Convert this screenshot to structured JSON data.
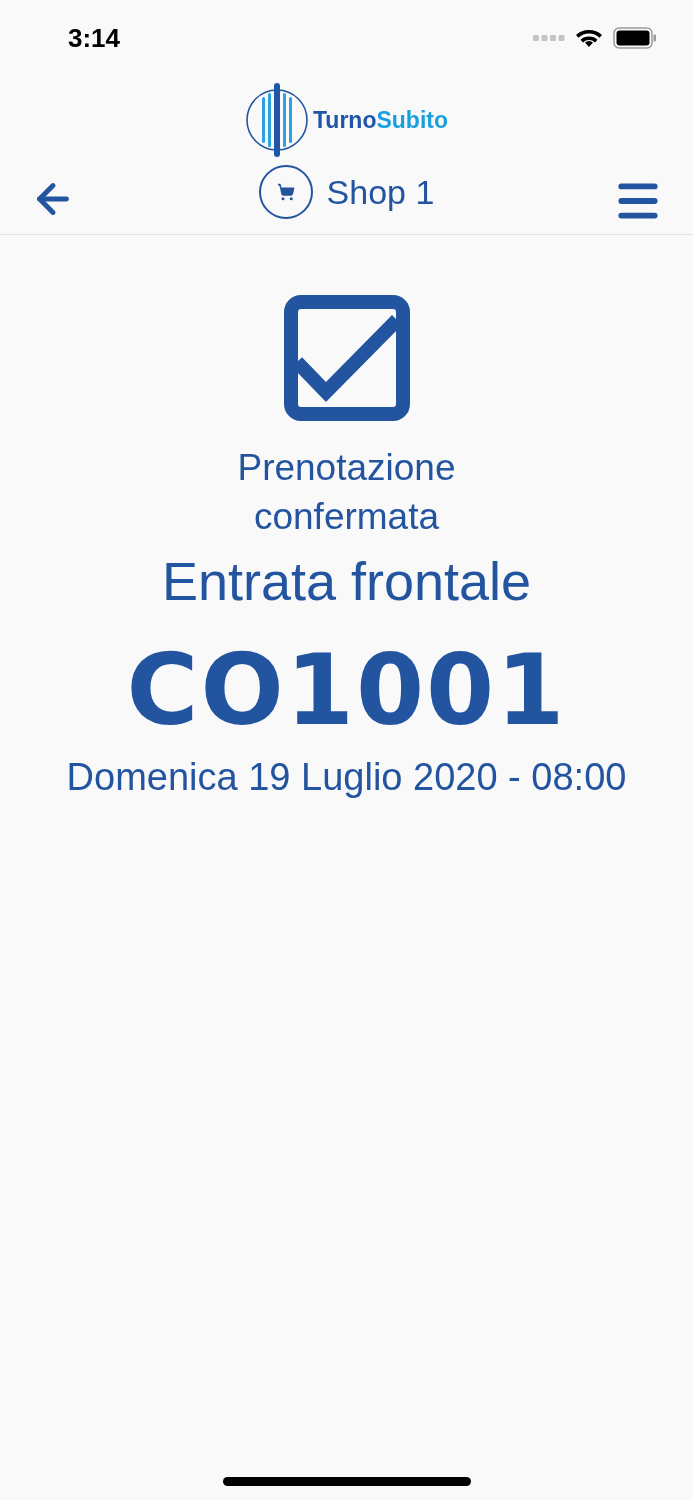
{
  "status_bar": {
    "time": "3:14"
  },
  "header": {
    "logo": {
      "first": "Turno",
      "second": "Subito"
    },
    "shop": "Shop 1"
  },
  "confirmation": {
    "status": "Prenotazione confermata",
    "entrance": "Entrata frontale",
    "code": "CO1001",
    "datetime": "Domenica 19 Luglio 2020 - 08:00"
  }
}
